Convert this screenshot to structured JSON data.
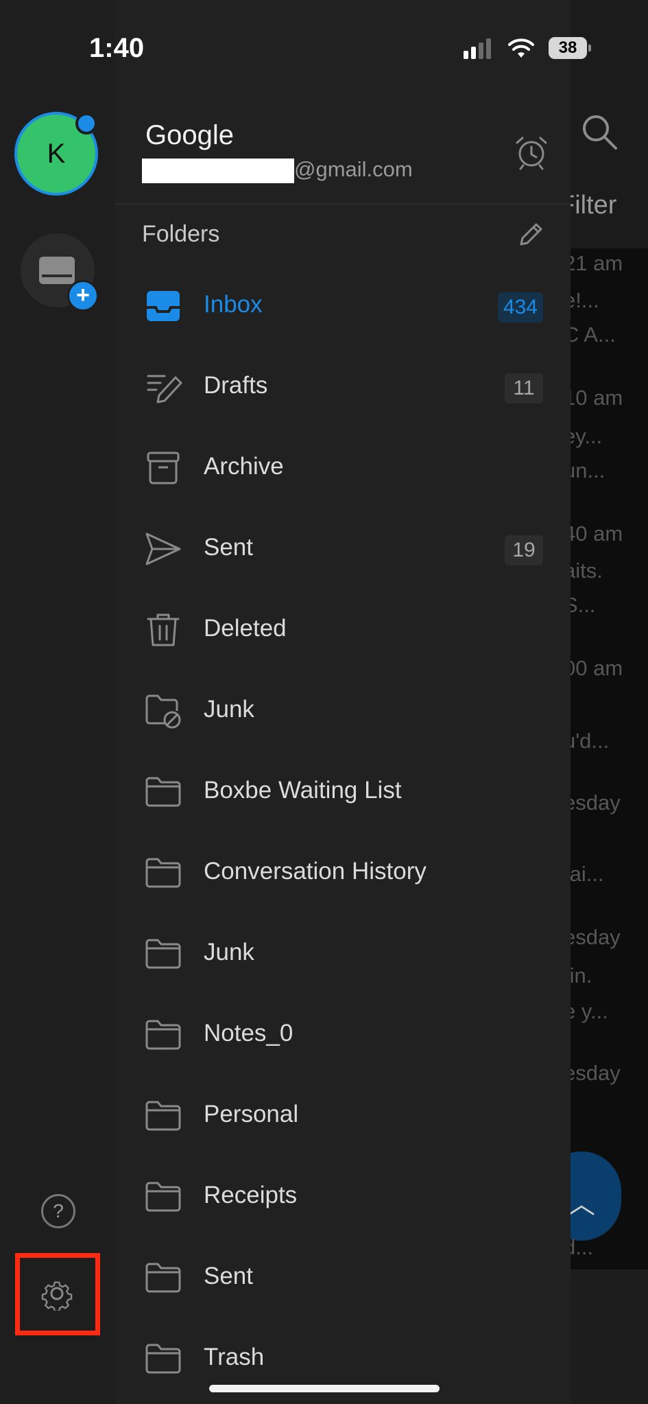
{
  "status": {
    "time": "1:40",
    "battery": "38"
  },
  "background": {
    "filter_label": "Filter",
    "snippets": [
      "21 am",
      "e!...",
      "C A...",
      "10 am",
      "ey...",
      "un...",
      "40 am",
      "aits.",
      "S...",
      "00 am",
      "u'd...",
      "esday",
      "tai...",
      "esday",
      ".in.",
      "e y...",
      "esday",
      "d..."
    ]
  },
  "account": {
    "avatar_initial": "K",
    "provider": "Google",
    "email_suffix": "@gmail.com"
  },
  "drawer": {
    "folders_label": "Folders",
    "folders": [
      {
        "label": "Inbox",
        "count": "434",
        "icon": "inbox-icon",
        "active": true
      },
      {
        "label": "Drafts",
        "count": "11",
        "icon": "drafts-icon"
      },
      {
        "label": "Archive",
        "count": "",
        "icon": "archive-icon"
      },
      {
        "label": "Sent",
        "count": "19",
        "icon": "sent-icon"
      },
      {
        "label": "Deleted",
        "count": "",
        "icon": "trash-icon"
      },
      {
        "label": "Junk",
        "count": "",
        "icon": "junk-icon"
      },
      {
        "label": "Boxbe Waiting List",
        "count": "",
        "icon": "folder-icon"
      },
      {
        "label": "Conversation History",
        "count": "",
        "icon": "folder-icon"
      },
      {
        "label": "Junk",
        "count": "",
        "icon": "folder-icon"
      },
      {
        "label": "Notes_0",
        "count": "",
        "icon": "folder-icon"
      },
      {
        "label": "Personal",
        "count": "",
        "icon": "folder-icon"
      },
      {
        "label": "Receipts",
        "count": "",
        "icon": "folder-icon"
      },
      {
        "label": "Sent",
        "count": "",
        "icon": "folder-icon"
      },
      {
        "label": "Trash",
        "count": "",
        "icon": "folder-icon"
      }
    ]
  },
  "rail": {
    "help_glyph": "?"
  },
  "colors": {
    "accent": "#1a8ce8",
    "highlight": "#ff2a12",
    "avatar": "#34c26b"
  }
}
